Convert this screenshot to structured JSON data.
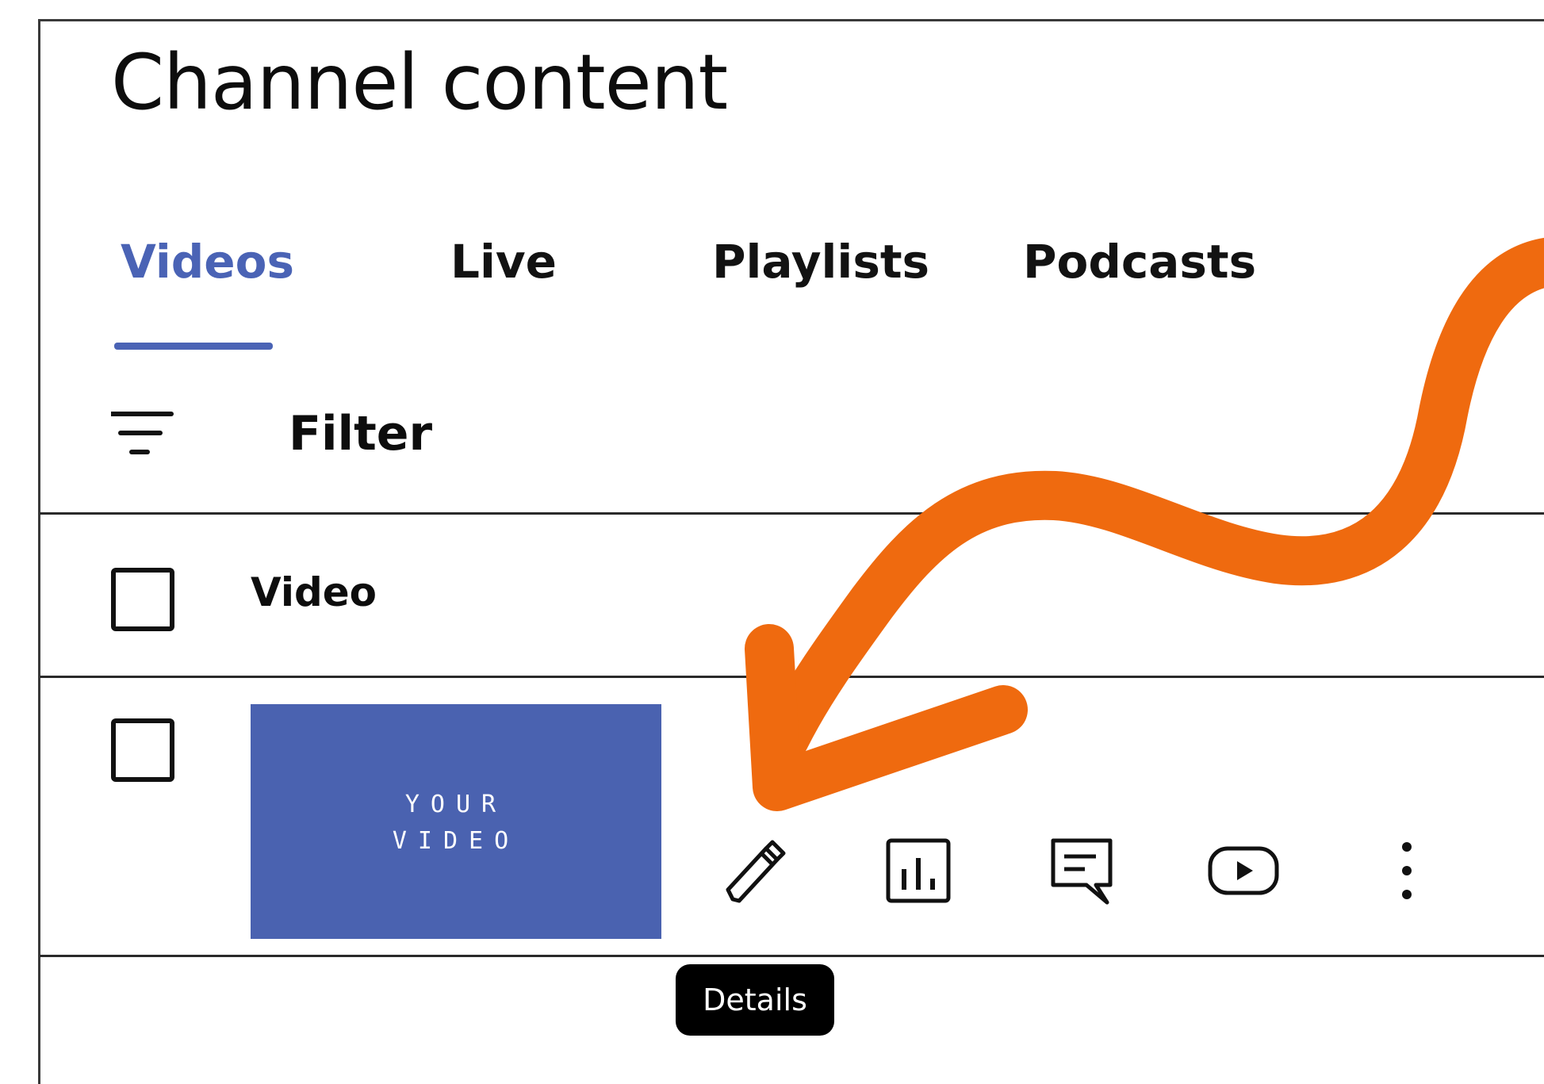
{
  "page": {
    "title": "Channel content"
  },
  "tabs": [
    {
      "label": "Videos",
      "active": true
    },
    {
      "label": "Live",
      "active": false
    },
    {
      "label": "Playlists",
      "active": false
    },
    {
      "label": "Podcasts",
      "active": false
    }
  ],
  "filter": {
    "label": "Filter",
    "icon": "filter-icon"
  },
  "table": {
    "column_header": "Video",
    "rows": [
      {
        "thumbnail_text_line1": "YOUR",
        "thumbnail_text_line2": "VIDEO",
        "actions": [
          {
            "icon": "pencil-icon",
            "name": "details"
          },
          {
            "icon": "analytics-icon",
            "name": "analytics"
          },
          {
            "icon": "comments-icon",
            "name": "comments"
          },
          {
            "icon": "play-icon",
            "name": "view-on-youtube"
          },
          {
            "icon": "more-vert-icon",
            "name": "options"
          }
        ]
      }
    ]
  },
  "tooltip": {
    "label": "Details"
  },
  "colors": {
    "accent": "#4a63b5",
    "thumbnail": "#4a62b0",
    "annotation_arrow": "#ef6a0f",
    "tooltip_bg": "#000000"
  }
}
